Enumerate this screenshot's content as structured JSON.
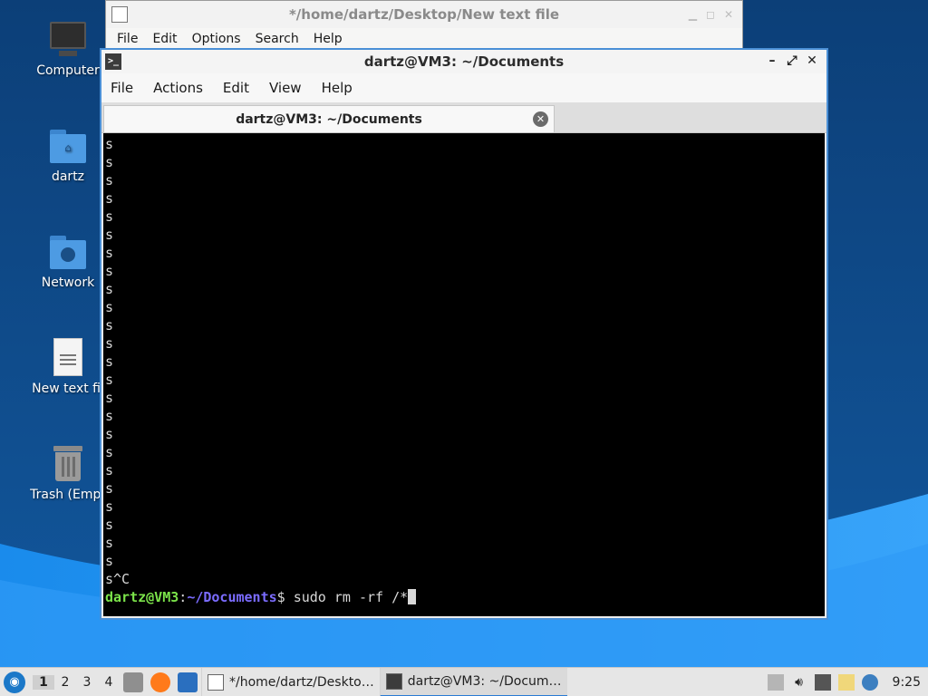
{
  "desktop": {
    "icons": [
      {
        "label": "Computer"
      },
      {
        "label": "dartz"
      },
      {
        "label": "Network"
      },
      {
        "label": "New text fil"
      },
      {
        "label": "Trash (Empt"
      }
    ]
  },
  "editor_window": {
    "title": "*/home/dartz/Desktop/New text file",
    "menu": [
      "File",
      "Edit",
      "Options",
      "Search",
      "Help"
    ]
  },
  "terminal_window": {
    "title": "dartz@VM3: ~/Documents",
    "menu": [
      "File",
      "Actions",
      "Edit",
      "View",
      "Help"
    ],
    "tab_label": "dartz@VM3: ~/Documents",
    "output_lines": [
      "s",
      "s",
      "s",
      "s",
      "s",
      "s",
      "s",
      "s",
      "s",
      "s",
      "s",
      "s",
      "s",
      "s",
      "s",
      "s",
      "s",
      "s",
      "s",
      "s",
      "s",
      "s",
      "s",
      "s",
      "s^C"
    ],
    "prompt": {
      "user_host": "dartz@VM3",
      "separator": ":",
      "path": "~/Documents",
      "symbol": "$",
      "command": " sudo rm -rf /*"
    },
    "colors": {
      "background": "#000000",
      "prompt_user": "#7be34a",
      "prompt_path": "#7b6cff"
    }
  },
  "taskbar": {
    "workspaces": [
      "1",
      "2",
      "3",
      "4"
    ],
    "active_workspace": "1",
    "tasks": [
      {
        "label": "*/home/dartz/Deskto…"
      },
      {
        "label": "dartz@VM3: ~/Docum…"
      }
    ],
    "clock": "9:25"
  },
  "icons": {
    "start": "lubuntu-logo-icon",
    "launchers": [
      "file-manager-icon",
      "firefox-icon",
      "show-desktop-icon"
    ],
    "tray": [
      "update-notifier-icon",
      "volume-icon",
      "network-icon",
      "clipboard-icon",
      "battery-icon"
    ]
  }
}
